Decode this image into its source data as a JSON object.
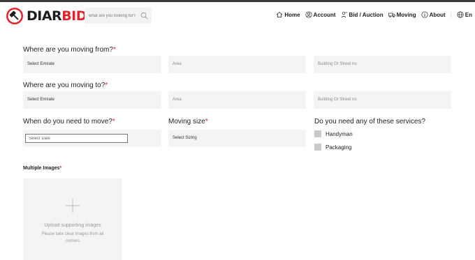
{
  "brand": {
    "name_part1": "DIAR",
    "name_part2": "BID"
  },
  "search": {
    "placeholder": "what are you looking for?"
  },
  "nav": {
    "home": "Home",
    "account": "Account",
    "bid_auction": "Bid / Auction",
    "moving": "Moving",
    "about": "About",
    "separator": "|",
    "language": "En"
  },
  "form": {
    "from": {
      "label": "Where are you moving from?",
      "required_mark": "*",
      "emirate": "Select Emirate",
      "area": "Area",
      "street": "Building Or Street no"
    },
    "to": {
      "label": "Where are you moving to?",
      "required_mark": "*",
      "emirate": "Select Emirate",
      "area": "Area",
      "street": "Building Or Street no"
    },
    "when": {
      "label": "When do you need to move?",
      "required_mark": "*",
      "placeholder": "Select Date"
    },
    "size": {
      "label": "Moving size",
      "required_mark": "*",
      "value": "Select Sizing"
    },
    "services": {
      "label": "Do you need any of these services?",
      "options": [
        "Handyman",
        "Packaging"
      ]
    },
    "images": {
      "label": "Multiple Images",
      "required_mark": "*",
      "upload_title": "Upload supporting images",
      "upload_hint": "Please take clear images from all corners"
    }
  },
  "colors": {
    "accent": "#e3232b",
    "dark": "#1d1d1d",
    "field_bg": "#f4f4f4"
  },
  "icons": [
    "logo-gavel-icon",
    "search-icon",
    "home-icon",
    "account-icon",
    "bid-icon",
    "truck-icon",
    "info-icon",
    "globe-icon",
    "plus-icon"
  ]
}
